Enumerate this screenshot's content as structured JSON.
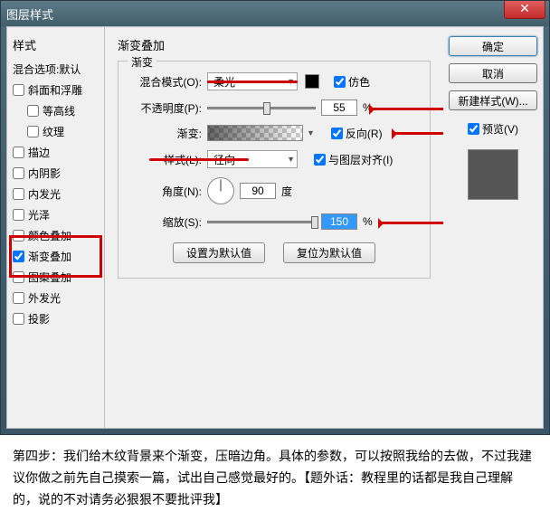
{
  "window": {
    "title": "图层样式"
  },
  "sidebar": {
    "title": "样式",
    "blend_options": "混合选项:默认",
    "items": [
      {
        "label": "斜面和浮雕",
        "checked": false
      },
      {
        "label": "等高线",
        "checked": false,
        "sub": true
      },
      {
        "label": "纹理",
        "checked": false,
        "sub": true
      },
      {
        "label": "描边",
        "checked": false
      },
      {
        "label": "内阴影",
        "checked": false
      },
      {
        "label": "内发光",
        "checked": false
      },
      {
        "label": "光泽",
        "checked": false
      },
      {
        "label": "颜色叠加",
        "checked": false
      },
      {
        "label": "渐变叠加",
        "checked": true,
        "highlight": true
      },
      {
        "label": "图案叠加",
        "checked": false
      },
      {
        "label": "外发光",
        "checked": false
      },
      {
        "label": "投影",
        "checked": false
      }
    ]
  },
  "main": {
    "group_title": "渐变叠加",
    "legend": "渐变",
    "blend_mode": {
      "label": "混合模式(O):",
      "value": "柔光"
    },
    "dither": {
      "label": "仿色",
      "checked": true
    },
    "opacity": {
      "label": "不透明度(P):",
      "value": "55",
      "unit": "%"
    },
    "gradient": {
      "label": "渐变:"
    },
    "reverse": {
      "label": "反向(R)",
      "checked": true
    },
    "style": {
      "label": "样式(L):",
      "value": "径向"
    },
    "align": {
      "label": "与图层对齐(I)",
      "checked": true
    },
    "angle": {
      "label": "角度(N):",
      "value": "90",
      "unit": "度"
    },
    "scale": {
      "label": "缩放(S):",
      "value": "150",
      "unit": "%"
    },
    "set_default": "设置为默认值",
    "reset_default": "复位为默认值"
  },
  "buttons": {
    "ok": "确定",
    "cancel": "取消",
    "new_style": "新建样式(W)...",
    "preview": {
      "label": "预览(V)",
      "checked": true
    }
  },
  "caption": "第四步：我们给木纹背景来个渐变，压暗边角。具体的参数，可以按照我给的去做，不过我建议你做之前先自己摸索一篇，试出自己感觉最好的。【题外话：教程里的话都是我自己理解的，说的不对请务必狠狠不要批评我】"
}
